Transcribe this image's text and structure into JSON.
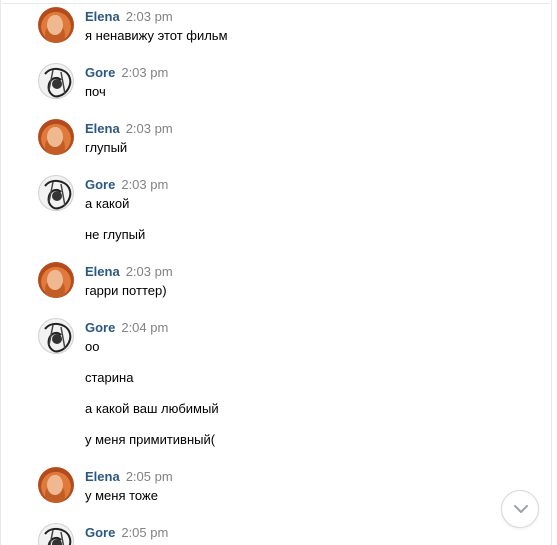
{
  "messages": [
    {
      "author": "Elena",
      "time": "2:03 pm",
      "lines": [
        "я ненавижу этот фильм"
      ]
    },
    {
      "author": "Gore",
      "time": "2:03 pm",
      "lines": [
        "поч"
      ]
    },
    {
      "author": "Elena",
      "time": "2:03 pm",
      "lines": [
        "глупый"
      ]
    },
    {
      "author": "Gore",
      "time": "2:03 pm",
      "lines": [
        "а какой",
        "не глупый"
      ]
    },
    {
      "author": "Elena",
      "time": "2:03 pm",
      "lines": [
        "гарри поттер)"
      ]
    },
    {
      "author": "Gore",
      "time": "2:04 pm",
      "lines": [
        "оо",
        "старина",
        "а какой ваш любимый",
        "у меня примитивный("
      ]
    },
    {
      "author": "Elena",
      "time": "2:05 pm",
      "lines": [
        "у меня тоже"
      ]
    },
    {
      "author": "Gore",
      "time": "2:05 pm",
      "lines": []
    }
  ],
  "colors": {
    "name": "#2a5885",
    "time": "#828282",
    "text": "#000000"
  },
  "icons": {
    "scroll_down": "chevron-down-icon"
  }
}
